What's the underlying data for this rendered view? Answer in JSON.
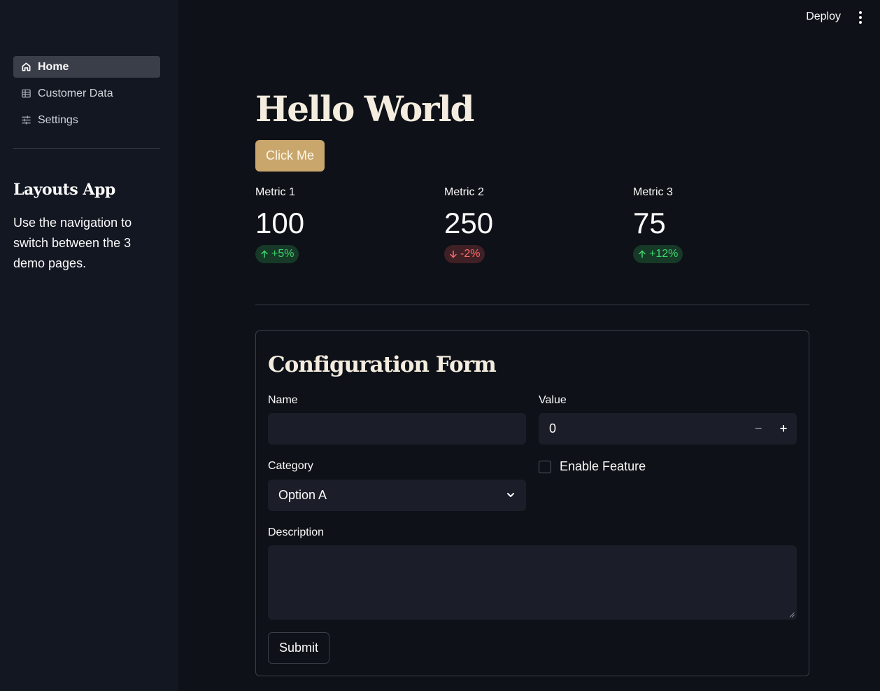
{
  "sidebar": {
    "nav": [
      {
        "label": "Home",
        "icon": "home-icon",
        "active": true
      },
      {
        "label": "Customer Data",
        "icon": "table-icon",
        "active": false
      },
      {
        "label": "Settings",
        "icon": "sliders-icon",
        "active": false
      }
    ],
    "title": "Layouts App",
    "description": "Use the navigation to switch between the 3 demo pages."
  },
  "topbar": {
    "deploy_label": "Deploy",
    "menu_icon": "kebab-menu-icon"
  },
  "main": {
    "title": "Hello World",
    "click_button": "Click Me",
    "metrics": [
      {
        "label": "Metric 1",
        "value": "100",
        "delta": "+5%",
        "direction": "up"
      },
      {
        "label": "Metric 2",
        "value": "250",
        "delta": "-2%",
        "direction": "down"
      },
      {
        "label": "Metric 3",
        "value": "75",
        "delta": "+12%",
        "direction": "up"
      }
    ]
  },
  "form": {
    "title": "Configuration Form",
    "name_label": "Name",
    "name_value": "",
    "value_label": "Value",
    "value_value": "0",
    "category_label": "Category",
    "category_selected": "Option A",
    "enable_feature_label": "Enable Feature",
    "enable_feature_checked": false,
    "description_label": "Description",
    "description_value": "",
    "submit_label": "Submit"
  },
  "colors": {
    "background": "#0e1117",
    "sidebar": "#131722",
    "accent": "#c9a66b",
    "positive": "#3dd56d",
    "negative": "#ff6c6c"
  }
}
